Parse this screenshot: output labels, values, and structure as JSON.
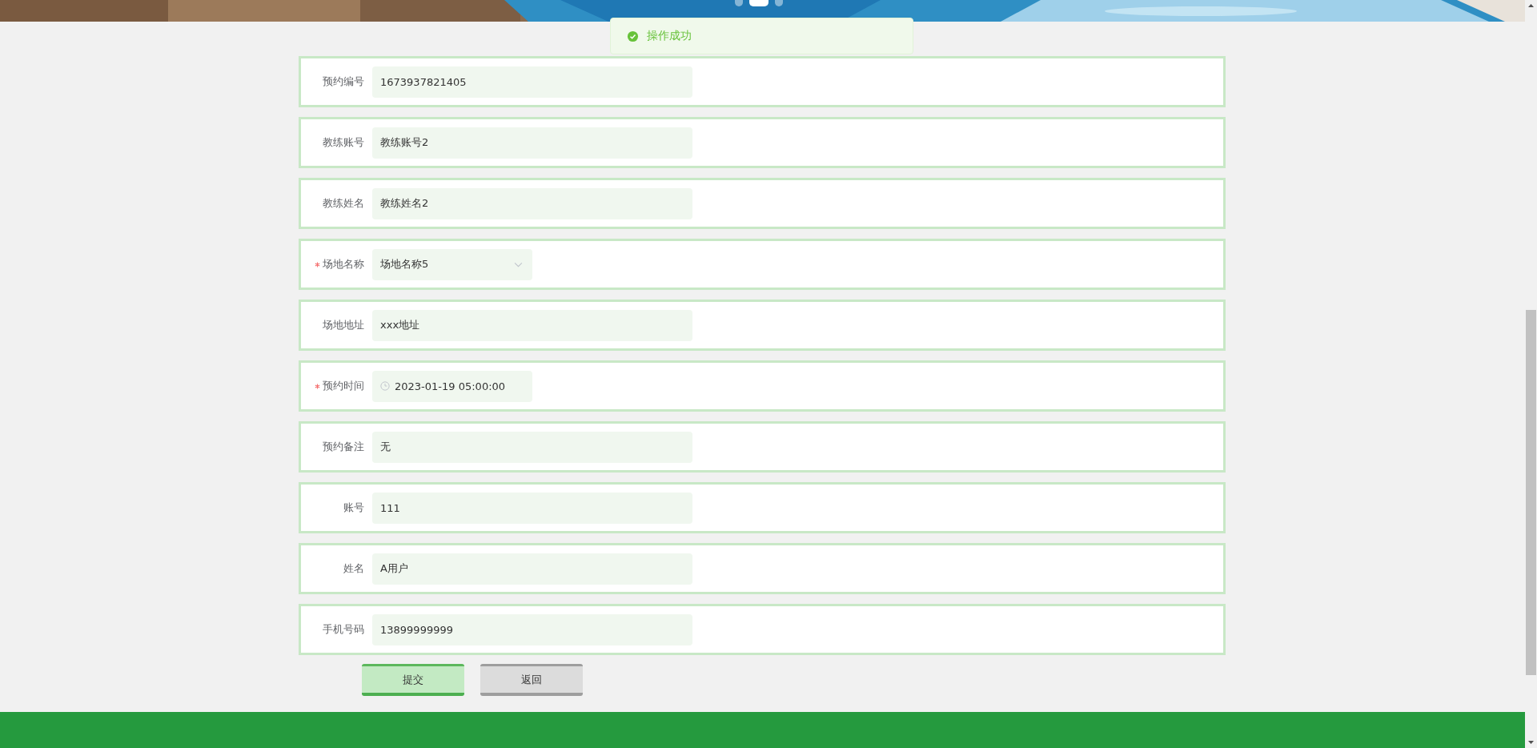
{
  "banner": {
    "kind": "picture",
    "dots": [
      {
        "selected": false
      },
      {
        "selected": true
      },
      {
        "selected": false
      }
    ]
  },
  "toast": {
    "message": "操作成功"
  },
  "form": {
    "fields": [
      {
        "label": "预约编号",
        "value": "1673937821405",
        "required": false,
        "kind": "text"
      },
      {
        "label": "教练账号",
        "value": "教练账号2",
        "required": false,
        "kind": "text"
      },
      {
        "label": "教练姓名",
        "value": "教练姓名2",
        "required": false,
        "kind": "text"
      },
      {
        "label": "场地名称",
        "value": "场地名称5",
        "required": true,
        "kind": "select"
      },
      {
        "label": "场地地址",
        "value": "xxx地址",
        "required": false,
        "kind": "text"
      },
      {
        "label": "预约时间",
        "value": "2023-01-19 05:00:00",
        "required": true,
        "kind": "datetime"
      },
      {
        "label": "预约备注",
        "value": "无",
        "required": false,
        "kind": "text"
      },
      {
        "label": "账号",
        "value": "111",
        "required": false,
        "kind": "text"
      },
      {
        "label": "姓名",
        "value": "A用户",
        "required": false,
        "kind": "text"
      },
      {
        "label": "手机号码",
        "value": "13899999999",
        "required": false,
        "kind": "text"
      }
    ]
  },
  "buttons": [
    {
      "label": "提交",
      "kind": "primary"
    },
    {
      "label": "返回",
      "kind": "secondary"
    }
  ]
}
